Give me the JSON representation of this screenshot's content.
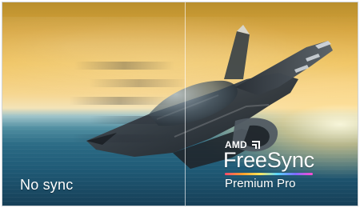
{
  "labels": {
    "left": "No sync",
    "brand_top": "AMD",
    "brand_main": "FreeSync",
    "brand_sub": "Premium Pro"
  },
  "colors": {
    "label_text": "#ffffff",
    "split_line": "#ffffff",
    "freesync_gradient": [
      "#ff4b6d",
      "#ff9e2a",
      "#ffe55b",
      "#54d6ff",
      "#7d6bff",
      "#ff4bd1"
    ]
  },
  "icons": {
    "amd_logo": "amd-logo-icon"
  }
}
